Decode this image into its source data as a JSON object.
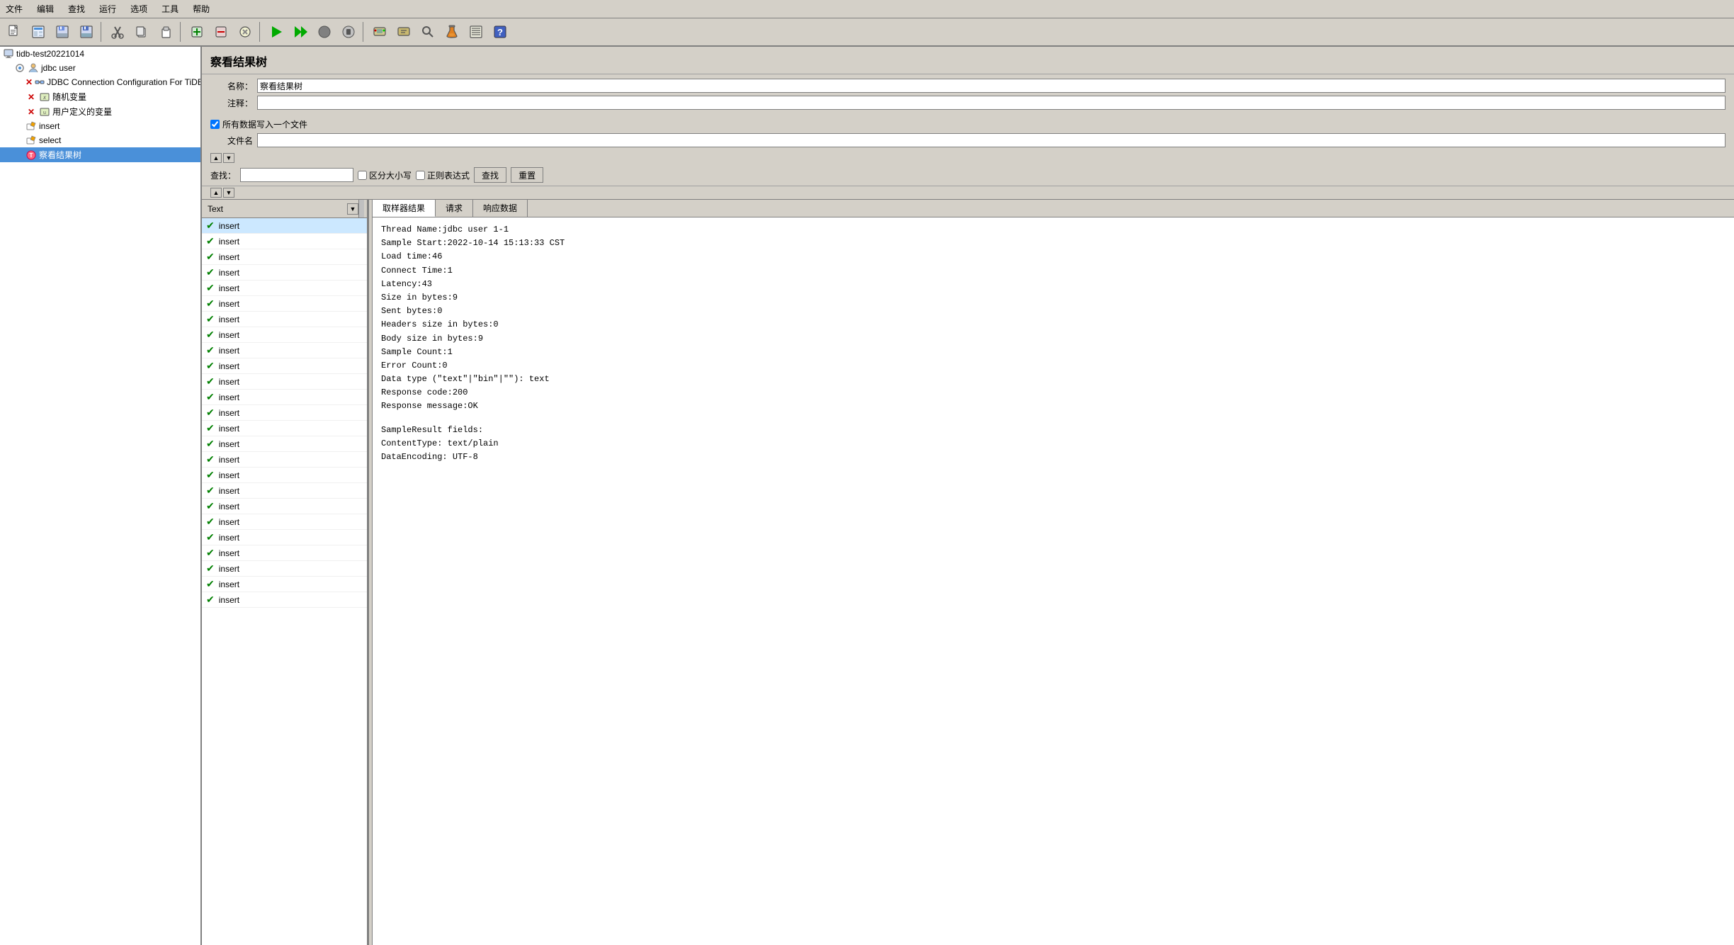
{
  "menubar": {
    "items": [
      "文件",
      "编辑",
      "查找",
      "运行",
      "选项",
      "工具",
      "帮助"
    ]
  },
  "toolbar": {
    "buttons": [
      {
        "name": "new-btn",
        "icon": "📄"
      },
      {
        "name": "open-btn",
        "icon": "📂"
      },
      {
        "name": "save-all-btn",
        "icon": "💾"
      },
      {
        "name": "save-btn",
        "icon": "💾"
      },
      {
        "name": "cut-btn",
        "icon": "✂️"
      },
      {
        "name": "copy-btn",
        "icon": "📋"
      },
      {
        "name": "paste-btn",
        "icon": "📄"
      },
      {
        "sep": true
      },
      {
        "name": "add-btn",
        "icon": "+"
      },
      {
        "name": "remove-btn",
        "icon": "−"
      },
      {
        "name": "clear-btn",
        "icon": "✕"
      },
      {
        "sep": true
      },
      {
        "name": "run-btn",
        "icon": "▶"
      },
      {
        "name": "run-no-pause-btn",
        "icon": "▶▶"
      },
      {
        "name": "stop-btn",
        "icon": "⏺"
      },
      {
        "name": "stop2-btn",
        "icon": "⏹"
      },
      {
        "sep": true
      },
      {
        "name": "search-btn",
        "icon": "🔍"
      },
      {
        "name": "tree-btn",
        "icon": "🌲"
      },
      {
        "name": "binoculars-btn",
        "icon": "🔭"
      },
      {
        "name": "flask-btn",
        "icon": "🧪"
      },
      {
        "name": "list-btn",
        "icon": "📋"
      },
      {
        "name": "help-btn",
        "icon": "?"
      }
    ]
  },
  "left_panel": {
    "tree": [
      {
        "label": "tidb-test20221014",
        "indent": 0,
        "icon": "computer",
        "arrow": "▾"
      },
      {
        "label": "jdbc user",
        "indent": 1,
        "icon": "user",
        "arrow": "▾"
      },
      {
        "label": "JDBC Connection Configuration For TiDB",
        "indent": 2,
        "icon": "link"
      },
      {
        "label": "随机变量",
        "indent": 2,
        "icon": "vars"
      },
      {
        "label": "用户定义的变量",
        "indent": 2,
        "icon": "vars"
      },
      {
        "label": "insert",
        "indent": 2,
        "icon": "pencil"
      },
      {
        "label": "select",
        "indent": 2,
        "icon": "pencil"
      },
      {
        "label": "察看结果树",
        "indent": 2,
        "icon": "tree",
        "selected": true
      }
    ]
  },
  "right_panel": {
    "title": "察看结果树",
    "form": {
      "name_label": "名称：",
      "name_value": "察看结果树",
      "comment_label": "注释：",
      "comment_value": "",
      "checkbox_label": "所有数据写入一个文件",
      "file_label": "文件名",
      "file_value": ""
    },
    "search": {
      "label": "查找：",
      "placeholder": "",
      "case_sensitive": "区分大小写",
      "regex": "正则表达式",
      "find_btn": "查找",
      "reset_btn": "重置"
    },
    "result_list": {
      "column_header": "Text",
      "rows": [
        "insert",
        "insert",
        "insert",
        "insert",
        "insert",
        "insert",
        "insert",
        "insert",
        "insert",
        "insert",
        "insert",
        "insert",
        "insert",
        "insert",
        "insert",
        "insert",
        "insert",
        "insert",
        "insert",
        "insert",
        "insert",
        "insert",
        "insert",
        "insert",
        "insert"
      ]
    },
    "detail_tabs": [
      "取样器结果",
      "请求",
      "响应数据"
    ],
    "active_tab": "取样器结果",
    "detail_content": {
      "lines": [
        "Thread Name:jdbc user 1-1",
        "Sample Start:2022-10-14 15:13:33 CST",
        "Load time:46",
        "Connect Time:1",
        "Latency:43",
        "Size in bytes:9",
        "Sent bytes:0",
        "Headers size in bytes:0",
        "Body size in bytes:9",
        "Sample Count:1",
        "Error Count:0",
        "Data type (\"text\"|\"bin\"|\"\"): text",
        "Response code:200",
        "Response message:OK",
        "",
        "SampleResult fields:",
        "ContentType: text/plain",
        "DataEncoding: UTF-8"
      ]
    }
  }
}
